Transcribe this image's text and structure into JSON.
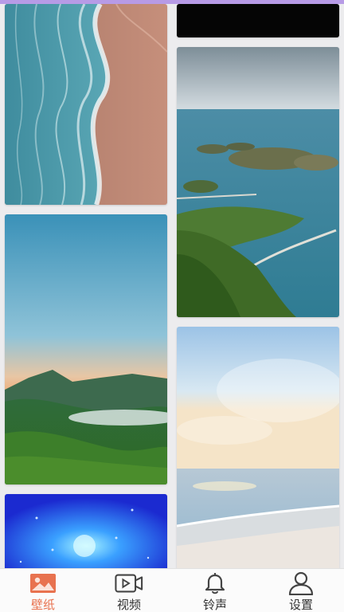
{
  "app": {
    "accent_color": "#e8724f",
    "topbar_color": "#b79be6"
  },
  "wallpapers": [
    {
      "subject": "beach-waves"
    },
    {
      "subject": "black"
    },
    {
      "subject": "islands-bridge"
    },
    {
      "subject": "mountain-sunset"
    },
    {
      "subject": "sea-shore"
    },
    {
      "subject": "blue-particles"
    }
  ],
  "tabbar": {
    "active": "wallpaper",
    "tabs": [
      {
        "id": "wallpaper",
        "label": "壁纸",
        "icon": "image-icon"
      },
      {
        "id": "video",
        "label": "视频",
        "icon": "video-icon"
      },
      {
        "id": "ringtone",
        "label": "铃声",
        "icon": "bell-icon"
      },
      {
        "id": "settings",
        "label": "设置",
        "icon": "user-icon"
      }
    ]
  }
}
